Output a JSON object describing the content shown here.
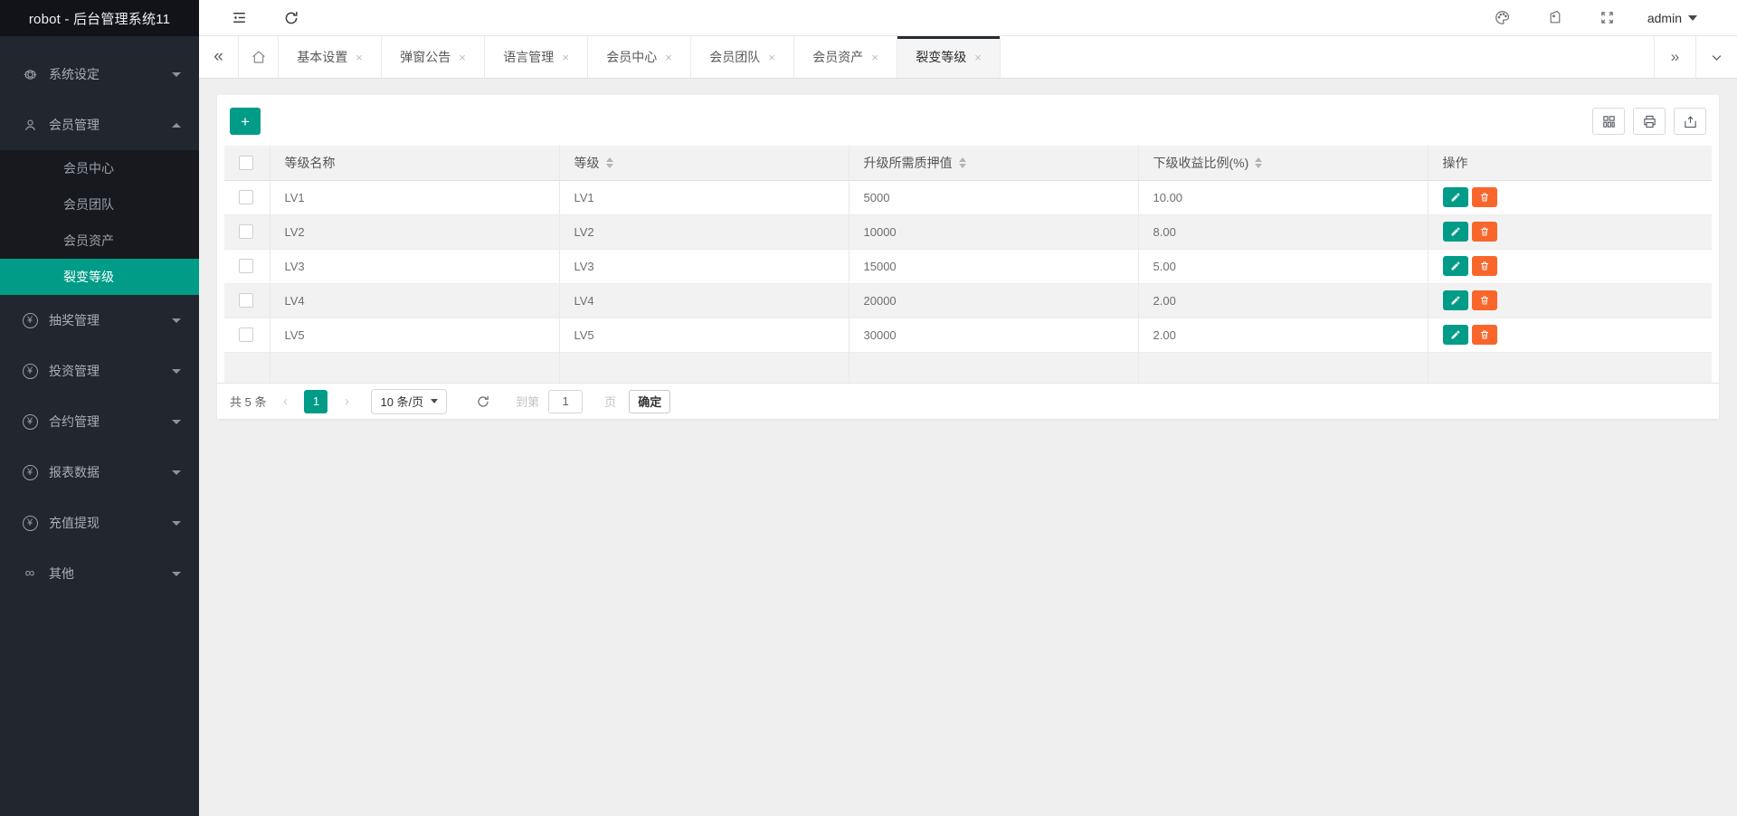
{
  "app": {
    "title": "robot - 后台管理系统11"
  },
  "topbar": {
    "user_label": "admin"
  },
  "colors": {
    "accent_teal": "#009c87",
    "accent_orange": "#f9662b",
    "sidebar_bg": "#22262e",
    "active_tab_bar": "#262a32"
  },
  "icons": {
    "collapse_left": "«",
    "expand_right": "»",
    "close": "×",
    "prev": "‹",
    "next": "›",
    "plus": "+",
    "yen": "¥",
    "infinity": "∞"
  },
  "sidebar": {
    "items": [
      {
        "label": "系统设定",
        "icon": "gear-icon",
        "state": "collapsed"
      },
      {
        "label": "会员管理",
        "icon": "user-icon",
        "state": "expanded",
        "children": [
          {
            "label": "会员中心"
          },
          {
            "label": "会员团队"
          },
          {
            "label": "会员资产"
          },
          {
            "label": "裂变等级",
            "active": true
          }
        ]
      },
      {
        "label": "抽奖管理",
        "icon": "yen-icon",
        "state": "collapsed"
      },
      {
        "label": "投资管理",
        "icon": "yen-icon",
        "state": "collapsed"
      },
      {
        "label": "合约管理",
        "icon": "yen-icon",
        "state": "collapsed"
      },
      {
        "label": "报表数据",
        "icon": "yen-icon",
        "state": "collapsed"
      },
      {
        "label": "充值提现",
        "icon": "yen-icon",
        "state": "collapsed"
      },
      {
        "label": "其他",
        "icon": "link-icon",
        "state": "collapsed"
      }
    ]
  },
  "tabs": {
    "items": [
      {
        "label": "基本设置"
      },
      {
        "label": "弹窗公告"
      },
      {
        "label": "语言管理"
      },
      {
        "label": "会员中心"
      },
      {
        "label": "会员团队"
      },
      {
        "label": "会员资产"
      },
      {
        "label": "裂变等级",
        "active": true
      }
    ]
  },
  "table": {
    "columns": [
      {
        "label": "等级名称",
        "sortable": false
      },
      {
        "label": "等级",
        "sortable": true
      },
      {
        "label": "升级所需质押值",
        "sortable": true
      },
      {
        "label": "下级收益比例(%)",
        "sortable": true
      },
      {
        "label": "操作",
        "sortable": false
      }
    ],
    "rows": [
      {
        "name": "LV1",
        "level": "LV1",
        "pledge": "5000",
        "ratio": "10.00"
      },
      {
        "name": "LV2",
        "level": "LV2",
        "pledge": "10000",
        "ratio": "8.00"
      },
      {
        "name": "LV3",
        "level": "LV3",
        "pledge": "15000",
        "ratio": "5.00"
      },
      {
        "name": "LV4",
        "level": "LV4",
        "pledge": "20000",
        "ratio": "2.00"
      },
      {
        "name": "LV5",
        "level": "LV5",
        "pledge": "30000",
        "ratio": "2.00"
      }
    ]
  },
  "pagination": {
    "total": "共 5 条",
    "page": "1",
    "page_size": "10 条/页",
    "goto_prefix": "到第",
    "goto_value": "1",
    "goto_suffix": "页",
    "confirm": "确定"
  }
}
